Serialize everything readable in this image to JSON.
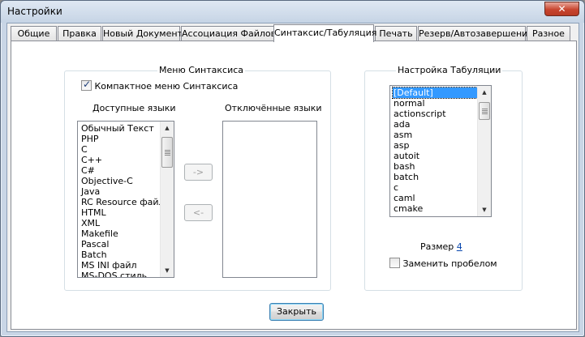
{
  "window": {
    "title": "Настройки",
    "close_glyph": "✕"
  },
  "tabs": [
    {
      "label": "Общие",
      "active": false
    },
    {
      "label": "Правка",
      "active": false
    },
    {
      "label": "Новый Документ",
      "active": false
    },
    {
      "label": "Ассоциация Файлов",
      "active": false
    },
    {
      "label": "Синтаксис/Табуляция",
      "active": true
    },
    {
      "label": "Печать",
      "active": false
    },
    {
      "label": "Резерв/Автозавершение",
      "active": false
    },
    {
      "label": "Разное",
      "active": false
    }
  ],
  "syntax_menu": {
    "title": "Меню Синтаксиса",
    "compact_checkbox": {
      "label": "Компактное меню Синтаксиса",
      "checked": true
    },
    "available_label": "Доступные языки",
    "disabled_label": "Отключённые языки",
    "available_languages": [
      "Обычный Текст",
      "PHP",
      "C",
      "C++",
      "C#",
      "Objective-C",
      "Java",
      "RC Resource файл",
      "HTML",
      "XML",
      "Makefile",
      "Pascal",
      "Batch",
      "MS INI файл",
      "MS-DOS стиль"
    ],
    "disabled_languages": [],
    "move_right_label": "->",
    "move_left_label": "<-"
  },
  "tab_settings": {
    "title": "Настройка Табуляции",
    "languages": [
      "[Default]",
      "normal",
      "actionscript",
      "ada",
      "asm",
      "asp",
      "autoit",
      "bash",
      "batch",
      "c",
      "caml",
      "cmake"
    ],
    "selected": "[Default]",
    "size_label": "Размер",
    "size_value": "4",
    "replace_checkbox": {
      "label": "Заменить пробелом",
      "checked": false
    }
  },
  "close_button": "Закрыть",
  "scroll_arrows": {
    "up": "▲",
    "down": "▼"
  }
}
